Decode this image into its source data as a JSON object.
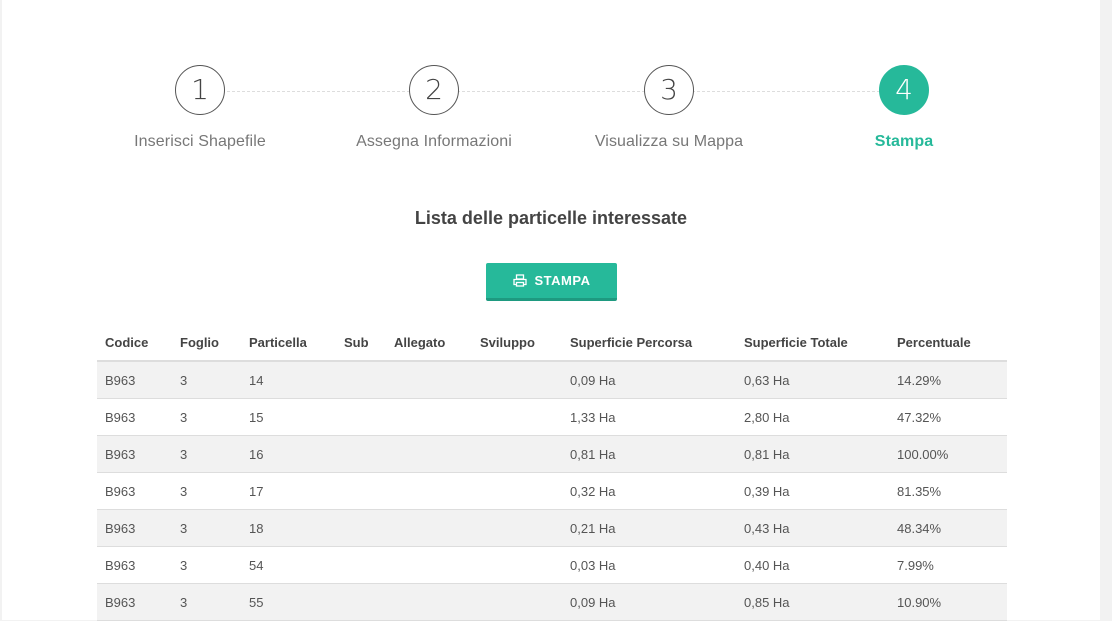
{
  "wizard": {
    "steps": [
      {
        "number": "1",
        "label": "Inserisci Shapefile"
      },
      {
        "number": "2",
        "label": "Assegna Informazioni"
      },
      {
        "number": "3",
        "label": "Visualizza su Mappa"
      },
      {
        "number": "4",
        "label": "Stampa"
      }
    ],
    "active_step": 4
  },
  "main": {
    "title": "Lista delle particelle interessate",
    "print_button_label": "STAMPA",
    "print_icon": "printer-icon"
  },
  "colors": {
    "accent": "#26b99a",
    "row_stripe": "#f2f2f2"
  },
  "table": {
    "headers": {
      "codice": "Codice",
      "foglio": "Foglio",
      "particella": "Particella",
      "sub": "Sub",
      "allegato": "Allegato",
      "sviluppo": "Sviluppo",
      "superficie_percorsa": "Superficie Percorsa",
      "superficie_totale": "Superficie Totale",
      "percentuale": "Percentuale"
    },
    "rows": [
      {
        "codice": "B963",
        "foglio": "3",
        "particella": "14",
        "sub": "",
        "allegato": "",
        "sviluppo": "",
        "sup_percorsa": "0,09 Ha",
        "sup_totale": "0,63 Ha",
        "percentuale": "14.29%"
      },
      {
        "codice": "B963",
        "foglio": "3",
        "particella": "15",
        "sub": "",
        "allegato": "",
        "sviluppo": "",
        "sup_percorsa": "1,33 Ha",
        "sup_totale": "2,80 Ha",
        "percentuale": "47.32%"
      },
      {
        "codice": "B963",
        "foglio": "3",
        "particella": "16",
        "sub": "",
        "allegato": "",
        "sviluppo": "",
        "sup_percorsa": "0,81 Ha",
        "sup_totale": "0,81 Ha",
        "percentuale": "100.00%"
      },
      {
        "codice": "B963",
        "foglio": "3",
        "particella": "17",
        "sub": "",
        "allegato": "",
        "sviluppo": "",
        "sup_percorsa": "0,32 Ha",
        "sup_totale": "0,39 Ha",
        "percentuale": "81.35%"
      },
      {
        "codice": "B963",
        "foglio": "3",
        "particella": "18",
        "sub": "",
        "allegato": "",
        "sviluppo": "",
        "sup_percorsa": "0,21 Ha",
        "sup_totale": "0,43 Ha",
        "percentuale": "48.34%"
      },
      {
        "codice": "B963",
        "foglio": "3",
        "particella": "54",
        "sub": "",
        "allegato": "",
        "sviluppo": "",
        "sup_percorsa": "0,03 Ha",
        "sup_totale": "0,40 Ha",
        "percentuale": "7.99%"
      },
      {
        "codice": "B963",
        "foglio": "3",
        "particella": "55",
        "sub": "",
        "allegato": "",
        "sviluppo": "",
        "sup_percorsa": "0,09 Ha",
        "sup_totale": "0,85 Ha",
        "percentuale": "10.90%"
      }
    ]
  }
}
